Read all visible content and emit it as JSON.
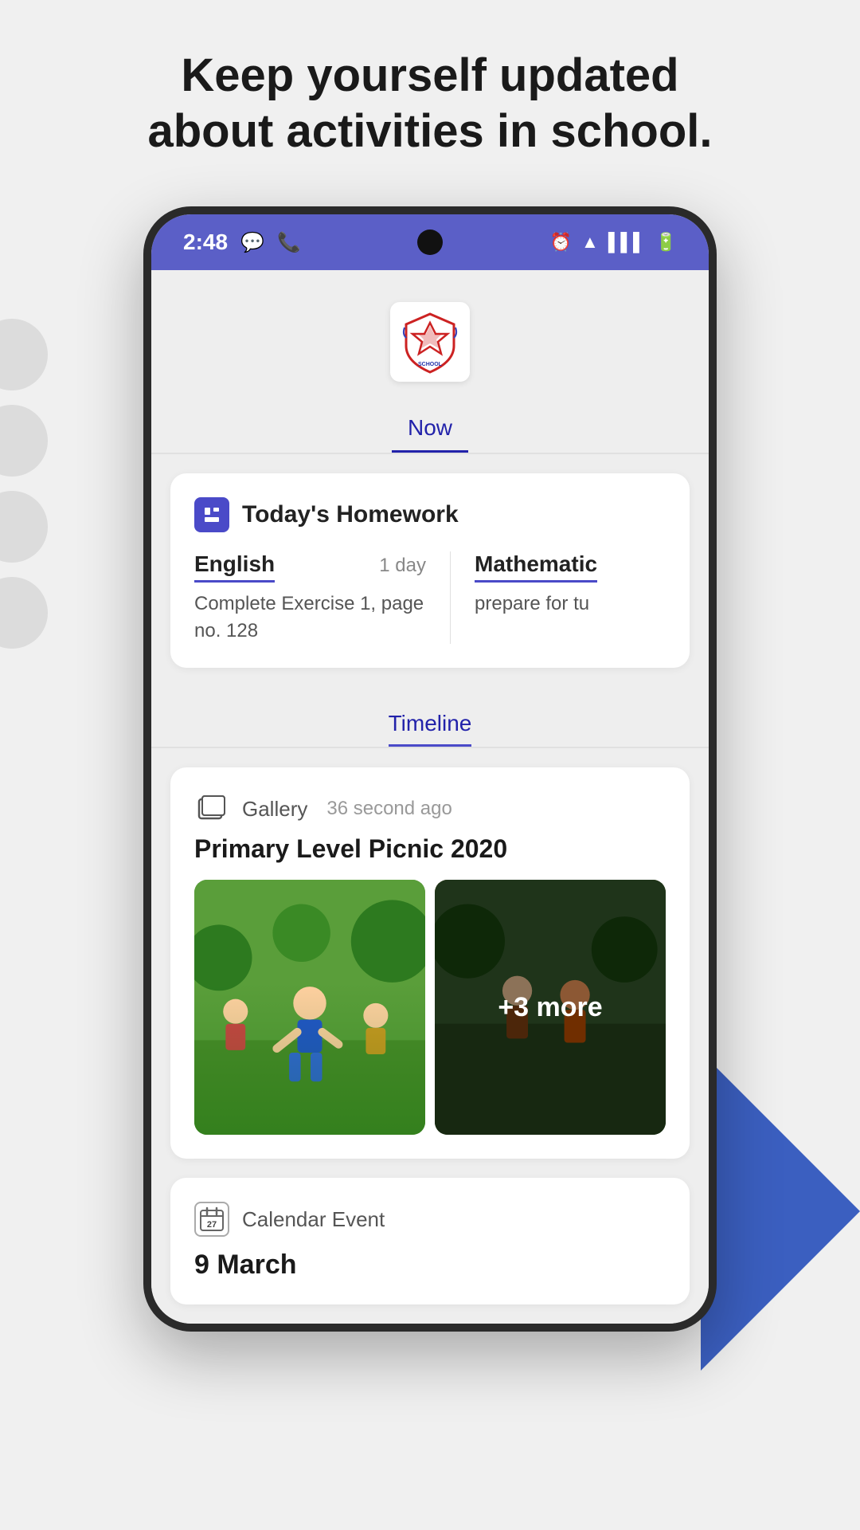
{
  "page": {
    "headline_line1": "Keep yourself updated",
    "headline_line2": "about activities in school."
  },
  "status_bar": {
    "time": "2:48",
    "icons_left": [
      "message-icon",
      "phone-icon"
    ],
    "icons_right": [
      "alarm-icon",
      "wifi-icon",
      "signal-icon",
      "battery-icon"
    ]
  },
  "tabs": [
    {
      "label": "Now",
      "active": true
    },
    {
      "label": "Timeline",
      "active": false
    }
  ],
  "timeline_tab": {
    "label": "Timeline"
  },
  "homework_card": {
    "title": "Today's Homework",
    "items": [
      {
        "subject": "English",
        "due": "1 day",
        "description": "Complete Exercise 1, page no. 128"
      },
      {
        "subject": "Mathematic",
        "due": "",
        "description": "prepare for tu"
      }
    ]
  },
  "gallery_event": {
    "type": "Gallery",
    "time_ago": "36 second ago",
    "title": "Primary Level Picnic 2020",
    "more_count": "+3 more"
  },
  "calendar_event": {
    "type": "Calendar Event",
    "date": "9 March"
  }
}
